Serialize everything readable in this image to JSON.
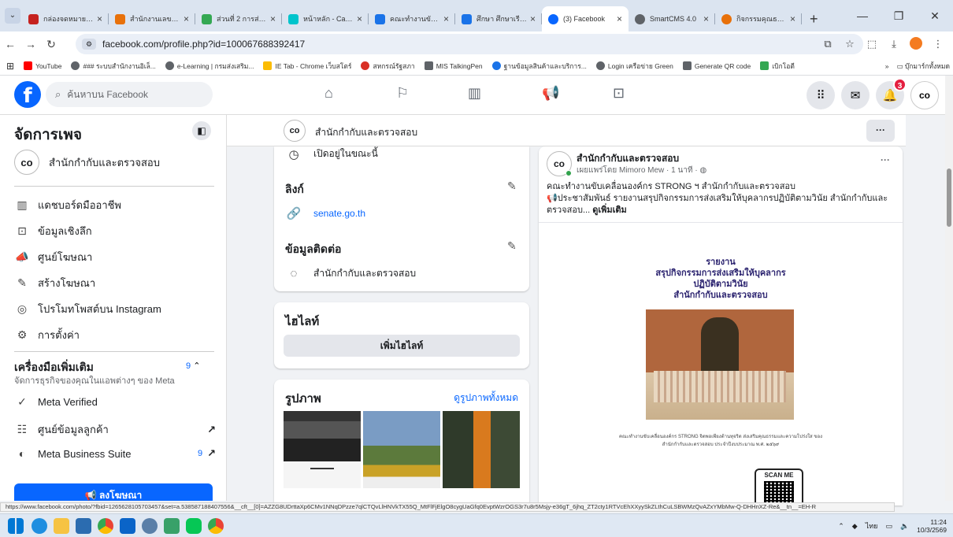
{
  "browser": {
    "tabs": [
      {
        "title": "กล่องจดหมาย - ร",
        "color": "#c5221f"
      },
      {
        "title": "สำนักงานเลขาธิก",
        "color": "#e8710a"
      },
      {
        "title": "ส่วนที่ 2 การส่งเส",
        "color": "#34a853"
      },
      {
        "title": "หน้าหลัก - Canva",
        "color": "#00c4cc"
      },
      {
        "title": "คณะทำงานขับเคลื่",
        "color": "#1a73e8"
      },
      {
        "title": "ศึกษา ศึกษาเรียน",
        "color": "#1a73e8"
      },
      {
        "title": "(3) Facebook",
        "color": "#0866ff"
      },
      {
        "title": "SmartCMS 4.0",
        "color": "#5f6368"
      },
      {
        "title": "กิจกรรมคุณธรรม",
        "color": "#e8710a"
      }
    ],
    "url": "facebook.com/profile.php?id=100067688392417",
    "bookmarks": [
      {
        "label": "YouTube",
        "color": "#ff0000"
      },
      {
        "label": "### ระบบสำนักงานอิเล็...",
        "color": "#5f6368"
      },
      {
        "label": "e-Learning | กรมส่งเสริม...",
        "color": "#5f6368"
      },
      {
        "label": "IE Tab - Chrome เว็บสโตร์",
        "color": "#fbbc04"
      },
      {
        "label": "สหกรณ์รัฐสภา",
        "color": "#d93025"
      },
      {
        "label": "MIS TalkingPen",
        "color": "#5f6368"
      },
      {
        "label": "ฐานข้อมูลสินค้าและบริการ...",
        "color": "#1a73e8"
      },
      {
        "label": "Login เครือข่าย Green",
        "color": "#5f6368"
      },
      {
        "label": "Generate QR code",
        "color": "#5f6368"
      },
      {
        "label": "เบิกโอตี",
        "color": "#34a853"
      }
    ],
    "bookmarks_more": "»",
    "bookmarks_folder": "บุ๊กมาร์กทั้งหมด",
    "status_url": "https://www.facebook.com/photo/?fbid=1265628105703457&set=a.538587188407556&__cft__[0]=AZZG8UDrttaXp6CMv1NNqDPzze7qlCTQvLlHNVkTX55Q_MtFlFjElgO8cygUaGfq0EvptWzrOGS3r7u8r5Msjy-e36gT_6jhq_ZT2cty1RTVcEhXXyySkZLthCuLSBWMzQvAZxYMbMw-Q-DHHnXZ-Re&__tn__=EH-R"
  },
  "facebook": {
    "search_placeholder": "ค้นหาบน Facebook",
    "notif_count": "3",
    "manage_title": "จัดการเพจ",
    "page_name": "สำนักกำกับและตรวจสอบ",
    "menu": [
      {
        "label": "แดชบอร์ดมืออาชีพ",
        "icon": "▥"
      },
      {
        "label": "ข้อมูลเชิงลึก",
        "icon": "⊡"
      },
      {
        "label": "ศูนย์โฆษณา",
        "icon": "📣"
      },
      {
        "label": "สร้างโฆษณา",
        "icon": "✎"
      },
      {
        "label": "โปรโมทโพสต์บน Instagram",
        "icon": "◎"
      },
      {
        "label": "การตั้งค่า",
        "icon": "⚙"
      }
    ],
    "tools_title": "เครื่องมือเพิ่มเติม",
    "tools_badge": "9",
    "tools_sub": "จัดการธุรกิจของคุณในแอพต่างๆ ของ Meta",
    "tools": [
      {
        "label": "Meta Verified",
        "icon": "✓",
        "count": "",
        "arrow": ""
      },
      {
        "label": "ศูนย์ข้อมูลลูกค้า",
        "icon": "☷",
        "count": "",
        "arrow": "↗"
      },
      {
        "label": "Meta Business Suite",
        "icon": "◐",
        "count": "9",
        "arrow": "↗"
      }
    ],
    "ad_button": "ลงโฆษณา",
    "open_now": "เปิดอยู่ในขณะนี้",
    "links_title": "ลิงก์",
    "link_url": "senate.go.th",
    "contact_title": "ข้อมูลติดต่อ",
    "contact_name": "สำนักกำกับและตรวจสอบ",
    "highlight_title": "ไฮไลท์",
    "add_highlight": "เพิ่มไฮไลท์",
    "photos_title": "รูปภาพ",
    "see_all_photos": "ดูรูปภาพทั้งหมด",
    "post": {
      "author": "สำนักกำกับและตรวจสอบ",
      "published_by": "เผยแพร่โดย Mimoro Mew · 1 นาที ·",
      "line1": "คณะทำงานขับเคลื่อนองค์กร STRONG ฯ สำนักกำกับและตรวจสอบ",
      "line2": "ประชาสัมพันธ์ รายงานสรุปกิจกรรมการส่งเสริมให้บุคลากรปฏิบัติตามวินัย สำนักกำกับและตรวจสอบ...",
      "see_more": "ดูเพิ่มเติม",
      "report_title": [
        "รายงาน",
        "สรุปกิจกรรมการส่งเสริมให้บุคลากร",
        "ปฏิบัติตามวินัย",
        "สำนักกำกับและตรวจสอบ"
      ],
      "caption": "คณะทำงานขับเคลื่อนองค์กร STRONG จิตพอเพียงต้านทุจริต ส่งเสริมคุณธรรมและความโปร่งใส ของสำนักกำกับและตรวจสอบ ประจำปีงบประมาณ พ.ศ. ๒๕๖๙",
      "scan_me": "SCAN ME"
    }
  },
  "taskbar": {
    "lang": "ไทย",
    "time": "11:24",
    "date": "10/3/2569"
  }
}
